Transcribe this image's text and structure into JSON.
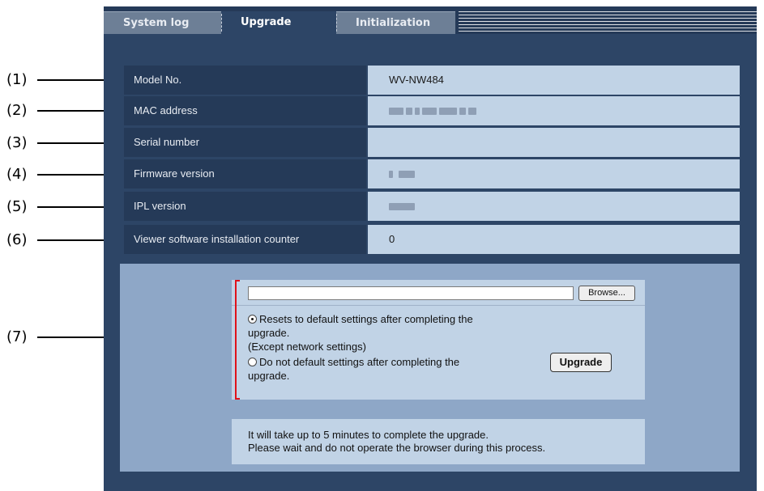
{
  "tabs": [
    {
      "label": "System log",
      "active": false
    },
    {
      "label": "Upgrade",
      "active": true
    },
    {
      "label": "Initialization",
      "active": false
    }
  ],
  "callouts": [
    "(1)",
    "(2)",
    "(3)",
    "(4)",
    "(5)",
    "(6)",
    "(7)"
  ],
  "info": {
    "model": {
      "label": "Model No.",
      "value": "WV-NW484"
    },
    "mac": {
      "label": "MAC address",
      "value": ""
    },
    "serial": {
      "label": "Serial number",
      "value": ""
    },
    "firmware": {
      "label": "Firmware version",
      "value": ""
    },
    "ipl": {
      "label": "IPL version",
      "value": ""
    },
    "viewer": {
      "label": "Viewer software installation counter",
      "value": "0"
    }
  },
  "upgrade": {
    "browse_label": "Browse...",
    "option_reset_line1": "Resets to default settings after completing the",
    "option_reset_line2": "upgrade.",
    "option_reset_line3": "(Except network settings)",
    "option_noreset_line1": "Do not default settings after completing the",
    "option_noreset_line2": "upgrade.",
    "selected_option": "reset",
    "upgrade_button": "Upgrade"
  },
  "note": {
    "line1": "It will take up to 5 minutes to complete the upgrade.",
    "line2": "Please wait and do not operate the browser during this process."
  },
  "colors": {
    "panel": "#2d4566",
    "label_bg": "#253a58",
    "value_bg": "#c1d3e6",
    "upgrade_area": "#8ea7c7",
    "bracket": "#e0121b"
  }
}
